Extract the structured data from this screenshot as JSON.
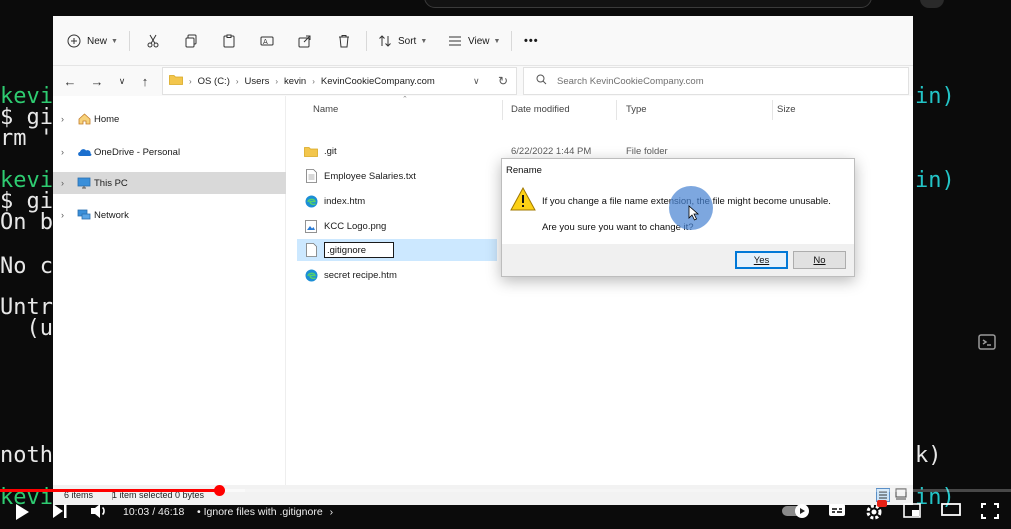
{
  "terminal": {
    "lines": [
      {
        "text": "kevi",
        "color": "green"
      },
      {
        "text": "$ git",
        "color": "white"
      },
      {
        "text": "rm 'i",
        "color": "white"
      },
      {
        "text": "kevi",
        "color": "green"
      },
      {
        "text": "$ git",
        "color": "white"
      },
      {
        "text": "On br",
        "color": "white"
      },
      {
        "text": "No co",
        "color": "white"
      },
      {
        "text": "Untra",
        "color": "white"
      },
      {
        "text": "  (us",
        "color": "white"
      },
      {
        "text": "nothi",
        "color": "white"
      },
      {
        "text": "kevi",
        "color": "green"
      }
    ],
    "right_fragments": [
      "in)",
      "in)",
      "k)",
      "in)"
    ]
  },
  "toolbar": {
    "new_label": "New",
    "sort_label": "Sort",
    "view_label": "View",
    "more_label": "•••"
  },
  "address": {
    "path": [
      "OS (C:)",
      "Users",
      "kevin",
      "KevinCookieCompany.com"
    ],
    "search_placeholder": "Search KevinCookieCompany.com"
  },
  "nav_pane": {
    "items": [
      {
        "label": "Home",
        "icon": "home-icon"
      },
      {
        "label": "OneDrive - Personal",
        "icon": "cloud-icon"
      },
      {
        "label": "This PC",
        "icon": "computer-icon"
      },
      {
        "label": "Network",
        "icon": "network-icon"
      }
    ]
  },
  "columns": {
    "name": "Name",
    "date": "Date modified",
    "type": "Type",
    "size": "Size"
  },
  "files": [
    {
      "name": ".git",
      "date": "6/22/2022 1:44 PM",
      "type": "File folder",
      "icon": "folder-icon"
    },
    {
      "name": "Employee Salaries.txt",
      "date": "",
      "type": "",
      "icon": "text-file-icon"
    },
    {
      "name": "index.htm",
      "date": "",
      "type": "",
      "icon": "edge-icon"
    },
    {
      "name": "KCC Logo.png",
      "date": "",
      "type": "",
      "icon": "image-file-icon"
    },
    {
      "name": ".gitignore",
      "date": "",
      "type": "",
      "icon": "file-icon",
      "renaming": true
    },
    {
      "name": "secret recipe.htm",
      "date": "",
      "type": "",
      "icon": "edge-icon"
    }
  ],
  "status": {
    "items": "6 items",
    "selected": "1 item selected  0 bytes"
  },
  "dialog": {
    "title": "Rename",
    "message": "If you change a file name extension, the file might become unusable.",
    "question": "Are you sure you want to change it?",
    "yes_label": "Yes",
    "no_label": "No"
  },
  "player": {
    "current_time": "10:03",
    "duration": "46:18",
    "time_display": "10:03 / 46:18",
    "chapter": "• Ignore files with .gitignore",
    "progress_fraction": 0.217,
    "accent": "#ff0000"
  }
}
